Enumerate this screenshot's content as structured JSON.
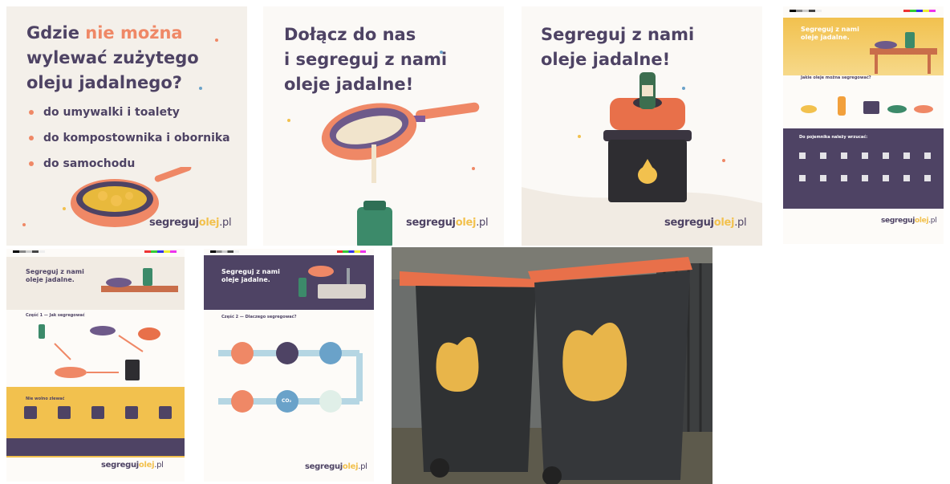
{
  "tile1": {
    "title_part1": "Gdzie ",
    "title_highlight": "nie można",
    "title_part2": "wylewać zużytego",
    "title_part3": "oleju jadalnego?",
    "bullets": [
      "do umywalki i toalety",
      "do kompostownika i obornika",
      "do samochodu"
    ]
  },
  "tile2": {
    "title_line1": "Dołącz do nas",
    "title_line2": "i segreguj z nami",
    "title_line3": "oleje jadalne!"
  },
  "tile3": {
    "title_line1": "Segreguj z nami",
    "title_line2": "oleje jadalne!"
  },
  "brand": {
    "part1": "segreguj",
    "part2": "olej",
    "part3": ".pl"
  },
  "poster1": {
    "title_line1": "Segreguj z nami",
    "title_line2": "oleje jadalne.",
    "section1": "Jakie oleje można segregować?",
    "section2": "Do pojemnika należy wrzucać:"
  },
  "poster2": {
    "title_line1": "Segreguj z nami",
    "title_line2": "oleje jadalne.",
    "section1": "Część 1 — Jak segregować",
    "section2": "Nie wolno zlewać"
  },
  "poster3": {
    "title_line1": "Segreguj z nami",
    "title_line2": "oleje jadalne.",
    "section1": "Część 2 — Dlaczego segregować?",
    "co2": "CO₂"
  },
  "colors": {
    "accent_orange": "#ef8866",
    "brand_yellow": "#f2c14e",
    "purple_dark": "#4e4364",
    "bin_dark": "#2e2d31",
    "lid_orange": "#e8704a"
  }
}
